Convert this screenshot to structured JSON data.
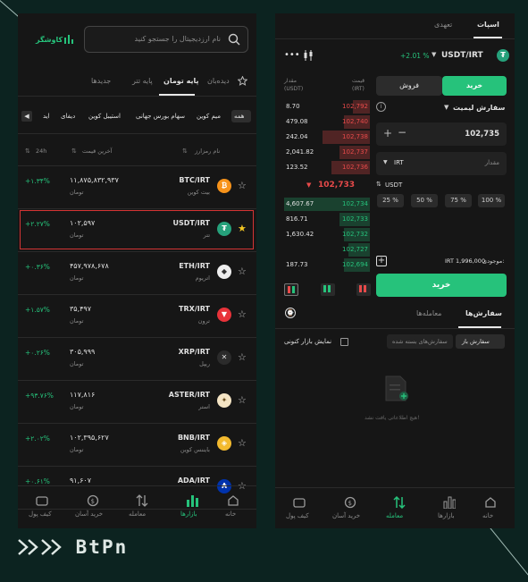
{
  "left": {
    "brand": "کاوشگر",
    "search_placeholder": "نام ارزدیجیتال را جستجو کنید",
    "tabs": [
      "جدیدها",
      "پایه تتر",
      "پایه تومان",
      "دیده‌بان"
    ],
    "categories": [
      "همه",
      "میم کوین",
      "سهام بورس جهانی",
      "استیبل کوین",
      "دیفای",
      "اید"
    ],
    "col_name": "نام رمزارز",
    "col_price": "آخرین قیمت",
    "col_change": "24h",
    "rows": [
      {
        "pair": "BTC/IRT",
        "name": "بیت کوین",
        "price": "۱۱,۸۷۵,۸۳۲,۹۳۷",
        "unit": "تومان",
        "change": "+۱.۳۴%",
        "fav": false
      },
      {
        "pair": "USDT/IRT",
        "name": "تتر",
        "price": "۱۰۲,۵۹۷",
        "unit": "تومان",
        "change": "+۲.۲۷%",
        "fav": true
      },
      {
        "pair": "ETH/IRT",
        "name": "اتریوم",
        "price": "۴۵۷,۹۷۸,۶۷۸",
        "unit": "تومان",
        "change": "+۰.۳۶%",
        "fav": false
      },
      {
        "pair": "TRX/IRT",
        "name": "ترون",
        "price": "۳۵,۴۹۷",
        "unit": "تومان",
        "change": "+۱.۵۷%",
        "fav": false
      },
      {
        "pair": "XRP/IRT",
        "name": "ریپل",
        "price": "۳۰۵,۹۹۹",
        "unit": "تومان",
        "change": "+۰.۲۶%",
        "fav": false
      },
      {
        "pair": "ASTER/IRT",
        "name": "استر",
        "price": "۱۱۷,۸۱۶",
        "unit": "تومان",
        "change": "+۹۳.۷۶%",
        "fav": false
      },
      {
        "pair": "BNB/IRT",
        "name": "بایننس کوین",
        "price": "۱۰۲,۳۹۵,۶۲۷",
        "unit": "تومان",
        "change": "+۲.۰۲%",
        "fav": false
      },
      {
        "pair": "ADA/IRT",
        "name": "",
        "price": "۹۱,۶۰۷",
        "unit": "",
        "change": "+۰.۶۱%",
        "fav": false
      }
    ],
    "nav": [
      "خانه",
      "بازارها",
      "معامله",
      "خرید آسان",
      "کیف پول"
    ]
  },
  "right": {
    "tabs": [
      "اسپات",
      "تعهدی"
    ],
    "pair": "USDT/IRT",
    "change": "+2.01 %",
    "col_price": "قیمت",
    "col_price_unit": "(IRT)",
    "col_amount": "مقدار",
    "col_amount_unit": "(USDT)",
    "asks": [
      {
        "price": "102,792",
        "amount": "8.70",
        "depth": 0.2
      },
      {
        "price": "102,740",
        "amount": "479.08",
        "depth": 0.3
      },
      {
        "price": "102,738",
        "amount": "242.04",
        "depth": 0.55
      },
      {
        "price": "102,737",
        "amount": "2,041.82",
        "depth": 0.35
      },
      {
        "price": "102,736",
        "amount": "123.52",
        "depth": 0.45
      }
    ],
    "mid_price": "102,733",
    "bids": [
      {
        "price": "102,734",
        "amount": "4,607.67",
        "depth": 1.0
      },
      {
        "price": "102,733",
        "amount": "816.71",
        "depth": 0.35
      },
      {
        "price": "102,732",
        "amount": "1,630.42",
        "depth": 0.3
      },
      {
        "price": "102,727",
        "amount": "",
        "depth": 0.25
      },
      {
        "price": "102,694",
        "amount": "187.73",
        "depth": 0.3
      }
    ],
    "buy_tab": "خرید",
    "sell_tab": "فروش",
    "order_type": "سفارش لیمیت",
    "price_value": "102,735",
    "amount_placeholder": "مقدار",
    "amount_unit": "IRT",
    "amount_unit2": "USDT",
    "percents": [
      "100 %",
      "75 %",
      "50 %",
      "25 %"
    ],
    "balance_label": "موجودی:",
    "balance_value": "IRT 1,996,000",
    "buy_button": "خرید",
    "orders_tabs": [
      "سفارش‌ها",
      "معامله‌ها"
    ],
    "open_orders": "سفارش باز",
    "closed_orders": "سفارش‌های بسته شده",
    "show_current": "نمایش بازار کنونی",
    "empty": "هیچ اطلاعاتی یافت نشد!",
    "nav": [
      "خانه",
      "بازارها",
      "معامله",
      "خرید آسان",
      "کیف پول"
    ]
  },
  "logo_text": "BtPn"
}
